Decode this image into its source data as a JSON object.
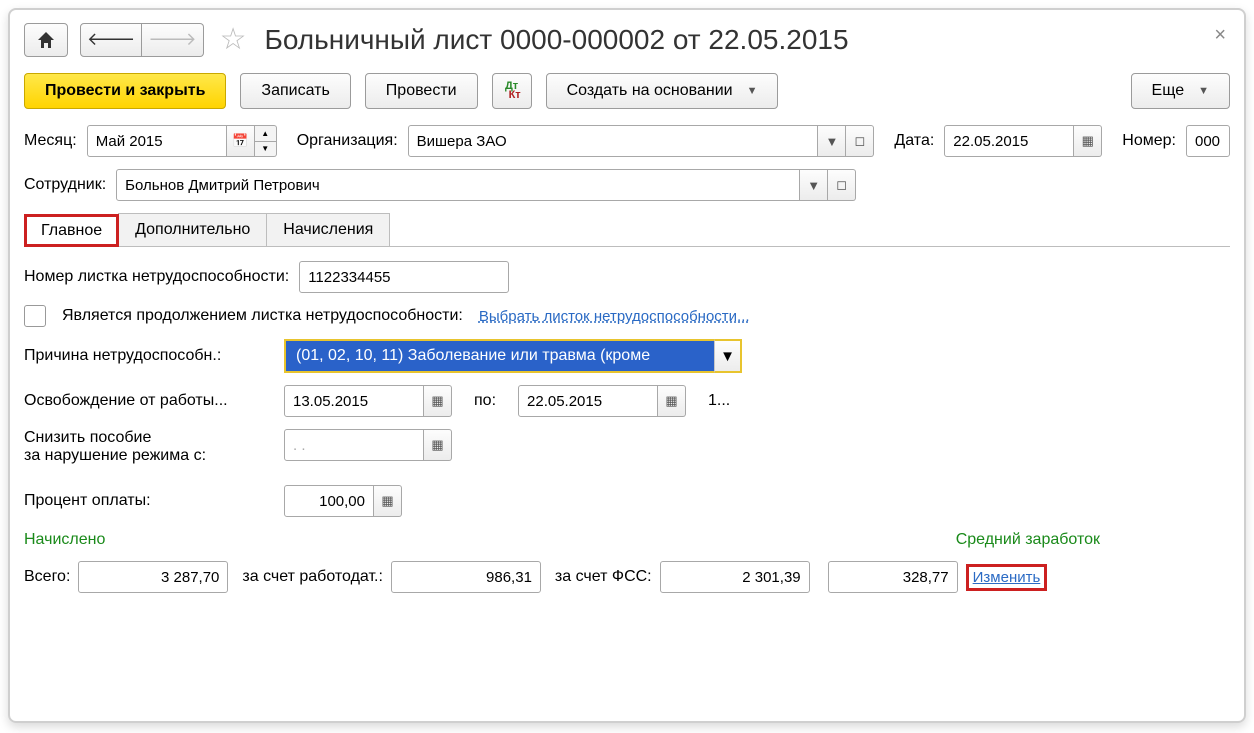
{
  "header": {
    "title": "Больничный лист 0000-000002 от 22.05.2015"
  },
  "toolbar": {
    "post_close": "Провести и закрыть",
    "save": "Записать",
    "post": "Провести",
    "create_based": "Создать на основании",
    "more": "Еще"
  },
  "fields": {
    "month_label": "Месяц:",
    "month_value": "Май 2015",
    "org_label": "Организация:",
    "org_value": "Вишера ЗАО",
    "date_label": "Дата:",
    "date_value": "22.05.2015",
    "number_label": "Номер:",
    "number_value": "000",
    "employee_label": "Сотрудник:",
    "employee_value": "Больнов Дмитрий Петрович"
  },
  "tabs": {
    "main": "Главное",
    "extra": "Дополнительно",
    "accruals": "Начисления"
  },
  "main": {
    "cert_no_label": "Номер листка нетрудоспособности:",
    "cert_no_value": "1122334455",
    "is_continuation_label": "Является продолжением листка нетрудоспособности:",
    "select_cert_link": "Выбрать листок нетрудоспособности...",
    "reason_label": "Причина нетрудоспособн.:",
    "reason_value": "(01, 02, 10, 11) Заболевание или травма (кроме",
    "off_work_label": "Освобождение от работы...",
    "off_from": "13.05.2015",
    "off_to_label": "по:",
    "off_to": "22.05.2015",
    "off_days": "1...",
    "reduce_label_1": "Снизить пособие",
    "reduce_label_2": "за нарушение режима с:",
    "reduce_value": "  .  .",
    "percent_label": "Процент оплаты:",
    "percent_value": "100,00"
  },
  "totals": {
    "accrued_header": "Начислено",
    "avg_header": "Средний заработок",
    "total_label": "Всего:",
    "total_value": "3 287,70",
    "employer_label": "за счет работодат.:",
    "employer_value": "986,31",
    "fss_label": "за счет ФСС:",
    "fss_value": "2 301,39",
    "avg_value": "328,77",
    "change_link": "Изменить"
  }
}
